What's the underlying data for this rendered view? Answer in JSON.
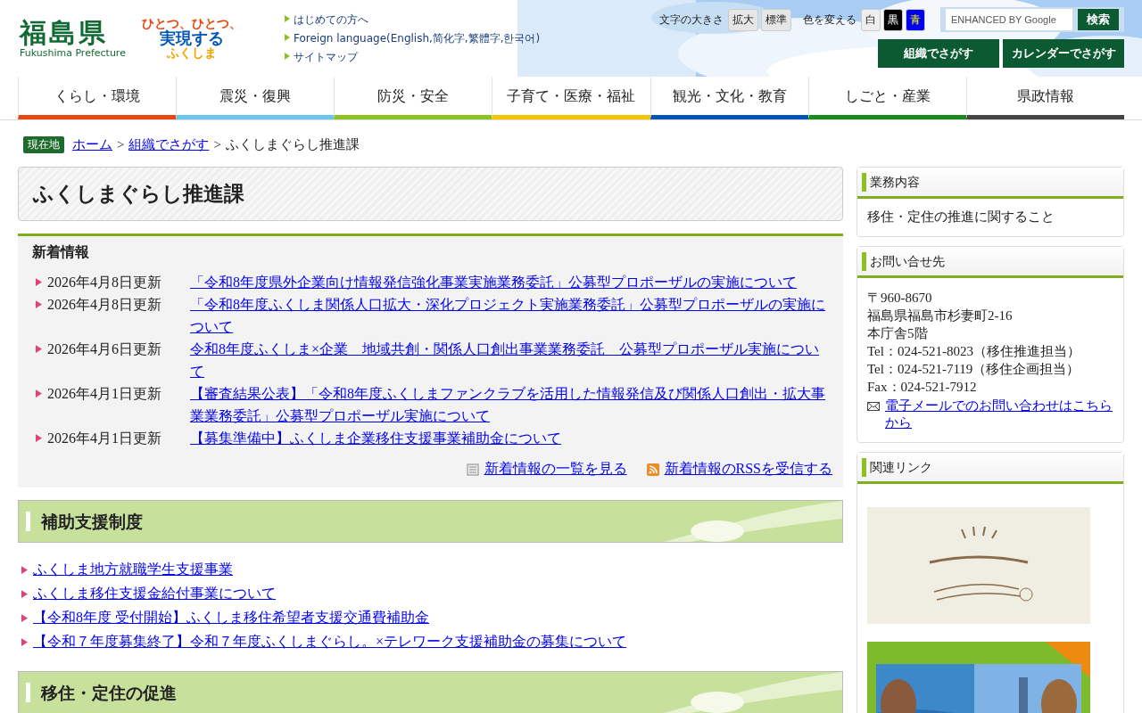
{
  "header": {
    "logo_title": "福島県",
    "logo_sub": "Fukushima Prefecture",
    "slogan": [
      "ひとつ、ひとつ、",
      "実現する",
      "ふくしま"
    ],
    "quick_links": [
      "はじめての方へ",
      "Foreign language(English,简化字,繁體字,한국어)",
      "サイトマップ"
    ],
    "text_size": {
      "label": "文字の大きさ",
      "buttons": [
        "拡大",
        "標準"
      ]
    },
    "color_change": {
      "label": "色を変える",
      "buttons": [
        {
          "label": "白",
          "kind": "white"
        },
        {
          "label": "黒",
          "kind": "black"
        },
        {
          "label": "青",
          "kind": "blue"
        }
      ]
    },
    "search": {
      "placeholder": "ENHANCED BY Google",
      "button": "検索"
    },
    "finder_buttons": [
      "組織でさがす",
      "カレンダーでさがす"
    ]
  },
  "nav": [
    {
      "label": "くらし・環境",
      "color": "#e8470f"
    },
    {
      "label": "震災・復興",
      "color": "#6ac5f0"
    },
    {
      "label": "防災・安全",
      "color": "#8cc220"
    },
    {
      "label": "子育て・医療・福祉",
      "color": "#f5c400"
    },
    {
      "label": "観光・文化・教育",
      "color": "#0054b8"
    },
    {
      "label": "しごと・産業",
      "color": "#1a8a1a"
    },
    {
      "label": "県政情報",
      "color": "#444444"
    }
  ],
  "breadcrumb": {
    "badge": "現在地",
    "links": [
      "ホーム",
      "組織でさがす"
    ],
    "separators": [
      ">",
      ">"
    ],
    "current": "ふくしまぐらし推進課"
  },
  "page_title": "ふくしまぐらし推進課",
  "news": {
    "heading": "新着情報",
    "items": [
      {
        "date": "2026年4月8日更新",
        "title": "「令和8年度県外企業向け情報発信強化事業実施業務委託」公募型プロポーザルの実施について"
      },
      {
        "date": "2026年4月8日更新",
        "title": "「令和8年度ふくしま関係人口拡大・深化プロジェクト実施業務委託」公募型プロポーザルの実施について"
      },
      {
        "date": "2026年4月6日更新",
        "title": "令和8年度ふくしま×企業　地域共創・関係人口創出事業業務委託　公募型プロポーザル実施について"
      },
      {
        "date": "2026年4月1日更新",
        "title": "【審査結果公表】「令和8年度ふくしまファンクラブを活用した情報発信及び関係人口創出・拡大事業業務委託」公募型プロポーザル実施について"
      },
      {
        "date": "2026年4月1日更新",
        "title": "【募集準備中】ふくしま企業移住支援事業補助金について"
      }
    ],
    "list_link": "新着情報の一覧を見る",
    "rss_link": "新着情報のRSSを受信する"
  },
  "sections": [
    {
      "heading": "補助支援制度",
      "links": [
        "ふくしま地方就職学生支援事業",
        "ふくしま移住支援金給付事業について",
        "【令和8年度 受付開始】ふくしま移住希望者支援交通費補助金",
        "【令和７年度募集終了】令和７年度ふくしまぐらし。×テレワーク支援補助金の募集について"
      ]
    },
    {
      "heading": "移住・定住の促進"
    }
  ],
  "sidebar": {
    "duties": {
      "heading": "業務内容",
      "text": "移住・定住の推進に関すること"
    },
    "contact": {
      "heading": "お問い合せ先",
      "lines": [
        "〒960-8670",
        "福島県福島市杉妻町2-16",
        "本庁舎5階",
        "Tel：024-521-8023（移住推進担当）",
        "Tel：024-521-7119（移住企画担当）",
        "Fax：024-521-7912"
      ],
      "mail_link": "電子メールでのお問い合わせはこちらから"
    },
    "related": {
      "heading": "関連リンク"
    }
  }
}
